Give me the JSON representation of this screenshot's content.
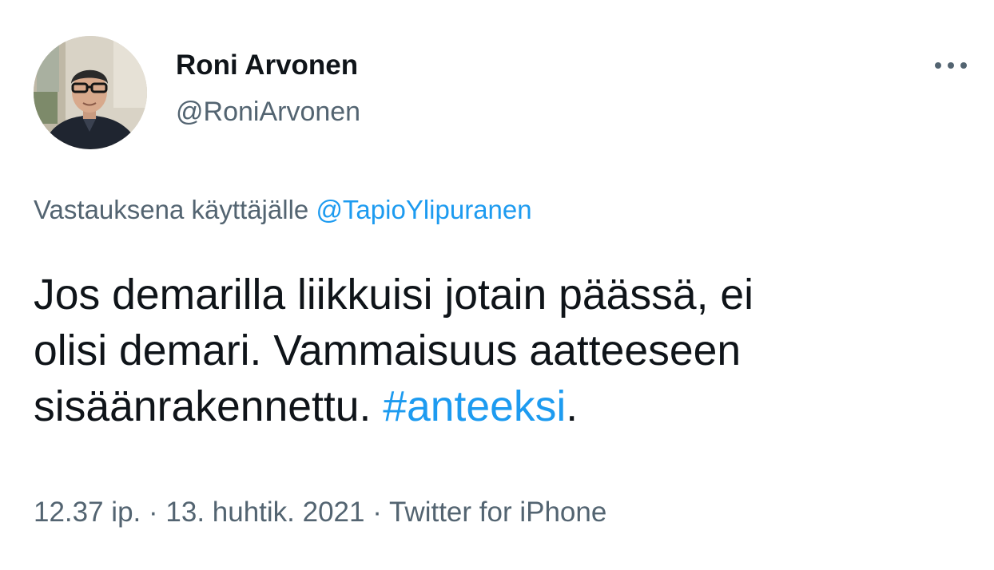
{
  "author": {
    "display_name": "Roni Arvonen",
    "handle": "@RoniArvonen",
    "avatar_icon": "profile-photo"
  },
  "more_icon": "ellipsis-icon",
  "reply_context": {
    "prefix": "Vastauksena käyttäjälle",
    "mention": "@TapioYlipuranen"
  },
  "tweet": {
    "line1": "Jos demarilla liikkuisi jotain päässä, ei",
    "line2": "olisi demari. Vammaisuus aatteeseen",
    "line3_text": "sisäänrakennettu.",
    "hashtag": "#anteeksi",
    "line3_end": "."
  },
  "meta": {
    "time": "12.37 ip.",
    "separator": "·",
    "date": "13. huhtik. 2021",
    "source": "Twitter for iPhone"
  },
  "colors": {
    "text": "#0f1419",
    "secondary": "#536471",
    "link": "#1d9bf0"
  }
}
